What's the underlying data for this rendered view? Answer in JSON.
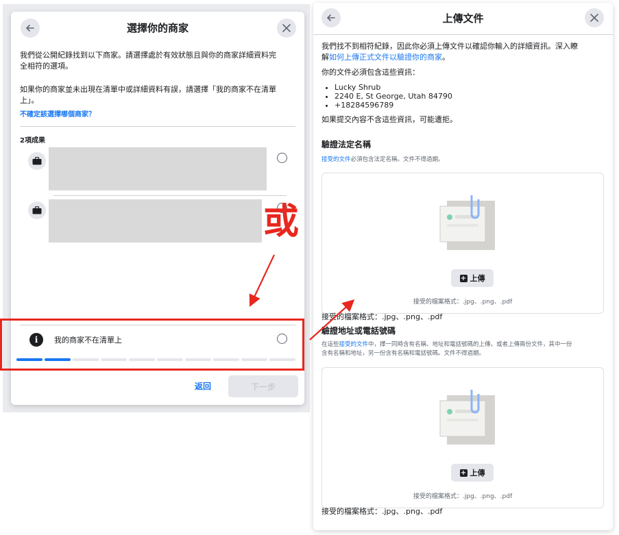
{
  "left_dialog": {
    "title": "選擇你的商家",
    "intro_line1": "我們從公開紀錄找到以下商家。請選擇處於有效狀態且與你的商家詳細資料完",
    "intro_line2": "全相符的選項。",
    "not_listed_line1": "如果你的商家並未出現在清單中或詳細資料有誤，請選擇「我的商家不在清單",
    "not_listed_line2": "上」。",
    "unsure_link": "不確定該選擇哪個商家？",
    "results_count": "2項成果",
    "not_in_list_option": "我的商家不在清單上",
    "progress": {
      "completed_steps": 2,
      "total_steps": 10
    },
    "back_button": "返回",
    "next_button": "下一步"
  },
  "right_dialog": {
    "title": "上傳文件",
    "intro_line1": "我們找不到相符紀錄，因此你必須上傳文件以確認你輸入的詳細資訊。深入瞭",
    "intro_line2_prefix": "解",
    "intro_link": "如何上傳正式文件以驗證你的商家",
    "intro_line2_suffix": "。",
    "must_contain": "你的文件必須包含這些資訊：",
    "business_info": [
      "Lucky Shrub",
      "2240 E, St George, Utah 84790",
      "+18284596789"
    ],
    "warning": "如果提交內容不含這些資訊，可能遭拒。",
    "section1": {
      "heading": "驗證法定名稱",
      "desc_link": "接受的文件",
      "desc_rest": "必須包含法定名稱。文件不得過期。",
      "upload_label": "上傳",
      "formats_inner": "接受的檔案格式：.jpg、.png、.pdf",
      "formats_outer": "接受的檔案格式：.jpg、.png、.pdf"
    },
    "section2": {
      "heading": "驗證地址或電話號碼",
      "desc_prefix": "在這些",
      "desc_link": "接受的文件",
      "desc_line1_rest": "中，擇一同時含有名稱、地址和電話號碼的上傳，或者上傳兩份文件，其中一份",
      "desc_line2": "含有名稱和地址，另一份含有名稱和電話號碼。文件不得過期。",
      "upload_label": "上傳",
      "formats_inner": "接受的檔案格式：.jpg、.png、.pdf",
      "formats_outer": "接受的檔案格式：.jpg、.png、.pdf"
    }
  },
  "annotation": {
    "or_label": "或",
    "color": "#e8271e"
  },
  "colors": {
    "accent": "#1877f2",
    "annotation_red": "#e8271e"
  }
}
